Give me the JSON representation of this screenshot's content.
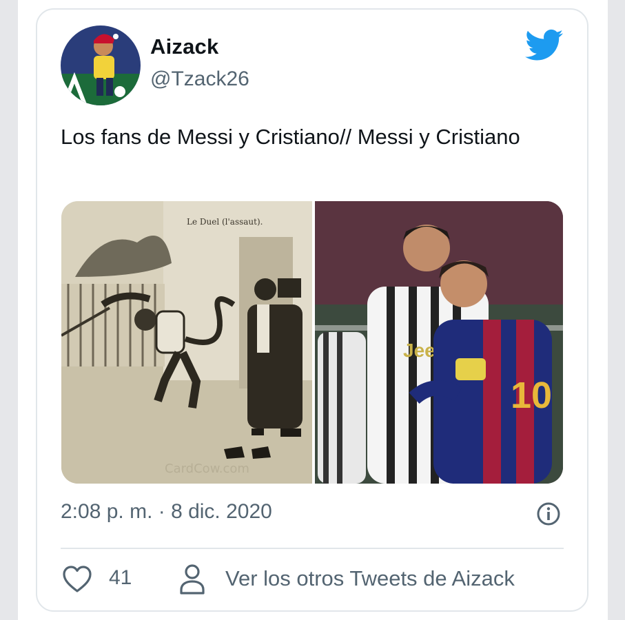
{
  "tweet": {
    "author_name": "Aizack",
    "author_handle": "@Tzack26",
    "text": "Los fans de Messi y Cristiano// Messi y Cristiano",
    "timestamp": "2:08 p. m. · 8 dic. 2020",
    "likes": "41",
    "other_tweets_label": "Ver los otros Tweets de Aizack"
  },
  "media": {
    "left_caption": "Le Duel (l'assaut).",
    "left_watermark": "CardCow.com",
    "jersey_sponsor": "Jeep",
    "jersey_number": "10"
  },
  "icons": {
    "logo": "twitter-bird-icon",
    "info": "info-icon",
    "like": "heart-icon",
    "profile": "person-icon"
  },
  "colors": {
    "twitter_blue": "#1d9bf0",
    "text_primary": "#0f1419",
    "text_secondary": "#536471",
    "border": "#e1e6ea"
  }
}
